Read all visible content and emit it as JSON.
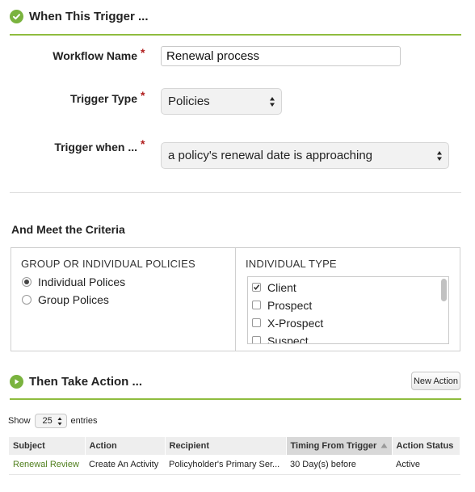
{
  "trigger_section": {
    "title": "When This Trigger ..."
  },
  "form": {
    "workflow_name_label": "Workflow Name",
    "workflow_name_value": "Renewal process",
    "trigger_type_label": "Trigger Type",
    "trigger_type_value": "Policies",
    "trigger_when_label": "Trigger when ...",
    "trigger_when_value": "a policy's renewal date is approaching",
    "required_mark": "*"
  },
  "criteria": {
    "title": "And Meet the Criteria",
    "group_heading": "GROUP OR INDIVIDUAL POLICIES",
    "group_options": [
      {
        "label": "Individual Polices",
        "selected": true
      },
      {
        "label": "Group Polices",
        "selected": false
      }
    ],
    "type_heading": "INDIVIDUAL TYPE",
    "type_options": [
      {
        "label": "Client",
        "checked": true
      },
      {
        "label": "Prospect",
        "checked": false
      },
      {
        "label": "X-Prospect",
        "checked": false
      },
      {
        "label": "Suspect",
        "checked": false
      }
    ]
  },
  "action_section": {
    "title": "Then Take Action ...",
    "new_action_label": "New Action",
    "show_label": "Show",
    "entries_value": "25",
    "entries_label": "entries"
  },
  "table": {
    "columns": [
      "Subject",
      "Action",
      "Recipient",
      "Timing From Trigger",
      "Action Status"
    ],
    "rows": [
      [
        "Renewal Review",
        "Create An Activity",
        "Policyholder's Primary Ser...",
        "30 Day(s) before",
        "Active"
      ]
    ]
  },
  "colors": {
    "accent_green": "#7ab33e",
    "rule_green": "#8fbc3f",
    "required_red": "#b01e1e",
    "link_green": "#4f7f1c"
  }
}
